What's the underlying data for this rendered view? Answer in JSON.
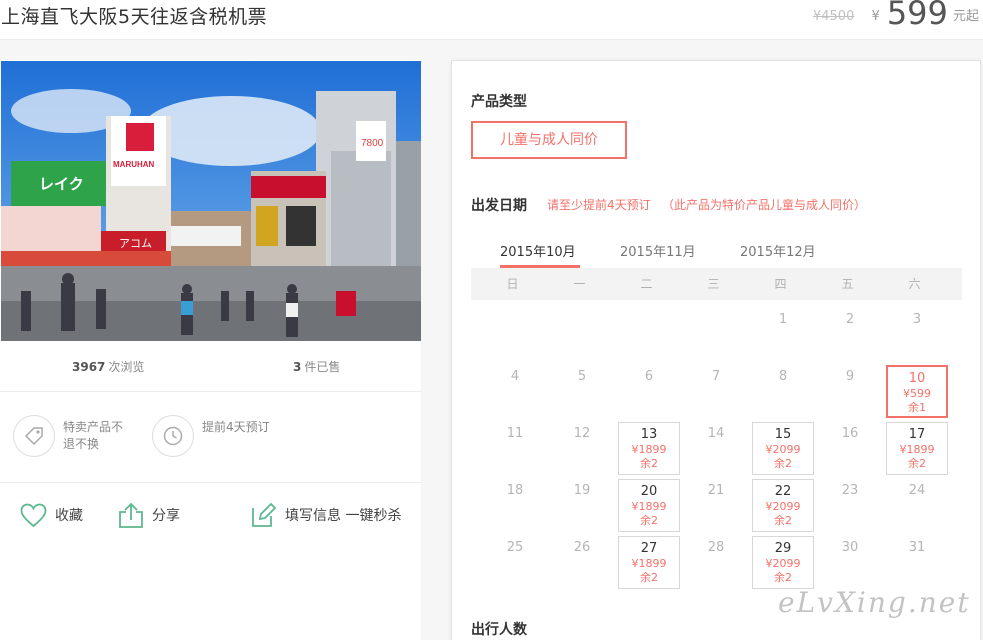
{
  "header": {
    "title": "上海直飞大阪5天往返含税机票",
    "original_price": "¥4500",
    "currency_symbol": "¥",
    "price": "599",
    "price_unit": "元起"
  },
  "stats": {
    "views_count": "3967",
    "views_label": "次浏览",
    "sold_count": "3",
    "sold_label": "件已售"
  },
  "features": [
    {
      "icon": "tag-icon",
      "text": "特卖产品不退不换"
    },
    {
      "icon": "clock-icon",
      "text": "提前4天预订"
    }
  ],
  "actions": {
    "favorite": "收藏",
    "share": "分享",
    "fill_info": "填写信息 一键秒杀"
  },
  "booking": {
    "product_type_label": "产品类型",
    "product_type_option": "儿童与成人同价",
    "date_label": "出发日期",
    "advance_note": "请至少提前4天预订",
    "price_note": "（此产品为特价产品儿童与成人同价）",
    "months": [
      "2015年10月",
      "2015年11月",
      "2015年12月"
    ],
    "weekdays": [
      "日",
      "一",
      "二",
      "三",
      "四",
      "五",
      "六"
    ],
    "passengers_label": "出行人数"
  },
  "calendar": [
    {
      "day": "1",
      "col": 4,
      "row": 0
    },
    {
      "day": "2",
      "col": 5,
      "row": 0
    },
    {
      "day": "3",
      "col": 6,
      "row": 0
    },
    {
      "day": "4",
      "col": 0,
      "row": 1
    },
    {
      "day": "5",
      "col": 1,
      "row": 1
    },
    {
      "day": "6",
      "col": 2,
      "row": 1
    },
    {
      "day": "7",
      "col": 3,
      "row": 1
    },
    {
      "day": "8",
      "col": 4,
      "row": 1
    },
    {
      "day": "9",
      "col": 5,
      "row": 1
    },
    {
      "day": "10",
      "col": 6,
      "row": 1,
      "price": "¥599",
      "remain": "余1",
      "selected": true
    },
    {
      "day": "11",
      "col": 0,
      "row": 2
    },
    {
      "day": "12",
      "col": 1,
      "row": 2
    },
    {
      "day": "13",
      "col": 2,
      "row": 2,
      "price": "¥1899",
      "remain": "余2"
    },
    {
      "day": "14",
      "col": 3,
      "row": 2
    },
    {
      "day": "15",
      "col": 4,
      "row": 2,
      "price": "¥2099",
      "remain": "余2"
    },
    {
      "day": "16",
      "col": 5,
      "row": 2
    },
    {
      "day": "17",
      "col": 6,
      "row": 2,
      "price": "¥1899",
      "remain": "余2"
    },
    {
      "day": "18",
      "col": 0,
      "row": 3
    },
    {
      "day": "19",
      "col": 1,
      "row": 3
    },
    {
      "day": "20",
      "col": 2,
      "row": 3,
      "price": "¥1899",
      "remain": "余2"
    },
    {
      "day": "21",
      "col": 3,
      "row": 3
    },
    {
      "day": "22",
      "col": 4,
      "row": 3,
      "price": "¥2099",
      "remain": "余2"
    },
    {
      "day": "23",
      "col": 5,
      "row": 3
    },
    {
      "day": "24",
      "col": 6,
      "row": 3
    },
    {
      "day": "25",
      "col": 0,
      "row": 4
    },
    {
      "day": "26",
      "col": 1,
      "row": 4
    },
    {
      "day": "27",
      "col": 2,
      "row": 4,
      "price": "¥1899",
      "remain": "余2"
    },
    {
      "day": "28",
      "col": 3,
      "row": 4
    },
    {
      "day": "29",
      "col": 4,
      "row": 4,
      "price": "¥2099",
      "remain": "余2"
    },
    {
      "day": "30",
      "col": 5,
      "row": 4
    },
    {
      "day": "31",
      "col": 6,
      "row": 4
    }
  ],
  "photo_signs": {
    "sign1": "MARUHAN",
    "sign2": "レイク",
    "sign3": "アコム",
    "sign4": "7800"
  },
  "watermark": "eLvXing.net",
  "colors": {
    "accent": "#f4716a",
    "icon_green": "#5cb88f"
  }
}
